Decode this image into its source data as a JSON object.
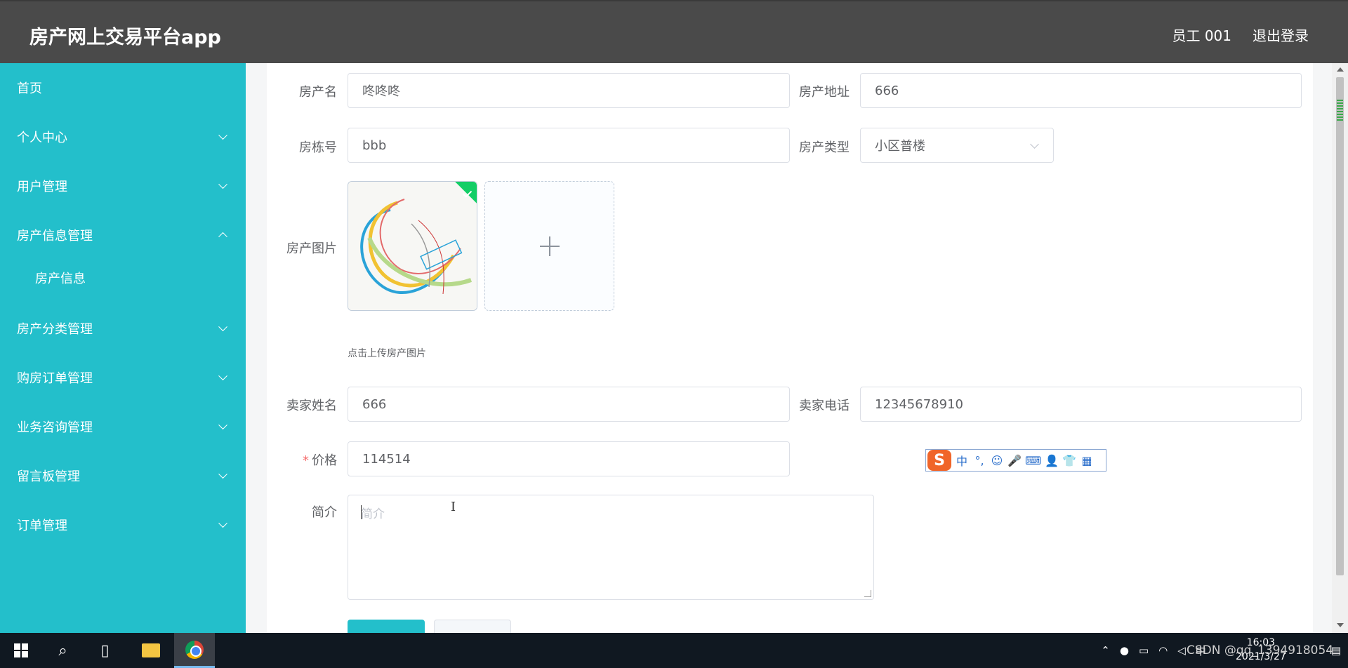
{
  "header": {
    "app_title": "房产网上交易平台app",
    "user": "员工 001",
    "logout": "退出登录"
  },
  "sidebar": {
    "items": [
      {
        "label": "首页",
        "expandable": false
      },
      {
        "label": "个人中心",
        "expandable": true
      },
      {
        "label": "用户管理",
        "expandable": true
      },
      {
        "label": "房产信息管理",
        "expandable": true,
        "expanded": true
      },
      {
        "label": "房产信息",
        "sub": true
      },
      {
        "label": "房产分类管理",
        "expandable": true
      },
      {
        "label": "购房订单管理",
        "expandable": true
      },
      {
        "label": "业务咨询管理",
        "expandable": true
      },
      {
        "label": "留言板管理",
        "expandable": true
      },
      {
        "label": "订单管理",
        "expandable": true
      }
    ]
  },
  "form": {
    "name_label": "房产名",
    "name_value": "咚咚咚",
    "address_label": "房产地址",
    "address_value": "666",
    "building_label": "房栋号",
    "building_value": "bbb",
    "type_label": "房产类型",
    "type_value": "小区普楼",
    "image_label": "房产图片",
    "image_tip": "点击上传房产图片",
    "seller_name_label": "卖家姓名",
    "seller_name_value": "666",
    "seller_phone_label": "卖家电话",
    "seller_phone_value": "12345678910",
    "price_required_mark": "*",
    "price_label": "价格",
    "price_value": "114514",
    "intro_label": "简介",
    "intro_placeholder": "简介"
  },
  "ime_toolbar": {
    "logo": "S",
    "items": [
      "中",
      "°,",
      "☺",
      "🎤",
      "⌨",
      "👤",
      "👕",
      "▦"
    ]
  },
  "taskbar": {
    "time": "16:03",
    "date": "2021/3/27",
    "tray_lang": "中",
    "watermark": "CSDN @qq_1394918054"
  },
  "colors": {
    "sidebar_bg": "#23bfcb",
    "header_bg": "#4a4a4a",
    "success": "#13ce66"
  }
}
